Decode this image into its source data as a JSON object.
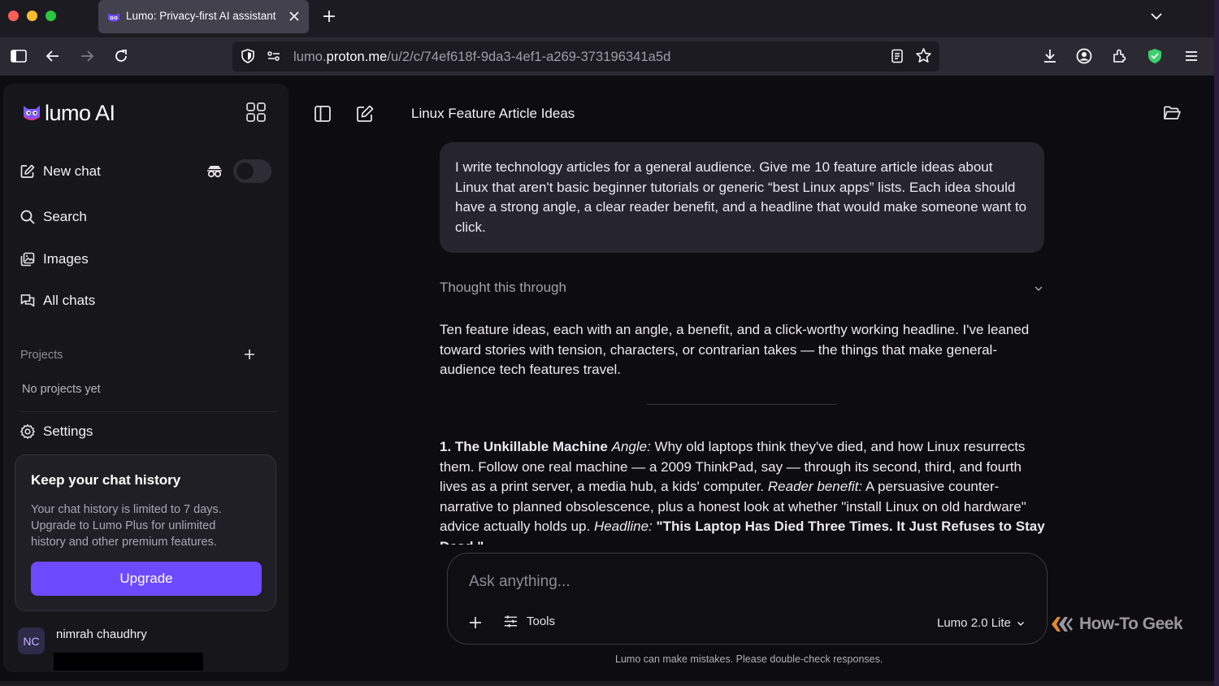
{
  "browser": {
    "tab_title": "Lumo: Privacy-first AI assistant",
    "url_prefix": "lumo.",
    "url_domain": "proton.me",
    "url_path": "/u/2/c/74ef618f-9da3-4ef1-a269-373196341a5d"
  },
  "sidebar": {
    "brand": "lumo AI",
    "items": [
      {
        "label": "New chat",
        "icon": "compose-icon"
      },
      {
        "label": "Search",
        "icon": "search-icon"
      },
      {
        "label": "Images",
        "icon": "images-icon"
      },
      {
        "label": "All chats",
        "icon": "chats-icon"
      }
    ],
    "projects_label": "Projects",
    "no_projects": "No projects yet",
    "settings_label": "Settings",
    "upsell": {
      "title": "Keep your chat history",
      "body": "Your chat history is limited to 7 days. Upgrade to Lumo Plus for unlimited history and other premium features.",
      "button": "Upgrade"
    },
    "user": {
      "initials": "NC",
      "name": "nimrah chaudhry"
    }
  },
  "main": {
    "chat_title": "Linux Feature Article Ideas",
    "user_message": "I write technology articles for a general audience. Give me 10 feature article ideas about Linux that aren't basic beginner tutorials or generic “best Linux apps” lists. Each idea should have a strong angle, a clear reader benefit, and a headline that would make someone want to click.",
    "thought_label": "Thought this through",
    "intro": "Ten feature ideas, each with an angle, a benefit, and a click-worthy working headline. I've leaned toward stories with tension, characters, or contrarian takes — the things that make general-audience tech features travel.",
    "idea_1": {
      "title": "1. The Unkillable Machine",
      "angle_label": "Angle:",
      "angle": " Why old laptops think they've died, and how Linux resurrects them. Follow one real machine — a 2009 ThinkPad, say — through its second, third, and fourth lives as a print server, a media hub, a kids' computer. ",
      "benefit_label": "Reader benefit:",
      "benefit": " A persuasive counter-narrative to planned obsolescence, plus a honest look at whether \"install Linux on old hardware\" advice actually holds up. ",
      "headline_label": "Headline:",
      "headline": " \"This Laptop Has Died Three Times. It Just Refuses to Stay Dead.\""
    },
    "composer": {
      "placeholder": "Ask anything...",
      "tools_label": "Tools",
      "model_label": "Lumo 2.0 Lite"
    },
    "disclaimer": "Lumo can make mistakes. Please double-check responses.",
    "watermark": "How-To Geek"
  },
  "colors": {
    "accent": "#6d4aff",
    "background": "#0d0c10",
    "sidebar": "#17161b"
  }
}
